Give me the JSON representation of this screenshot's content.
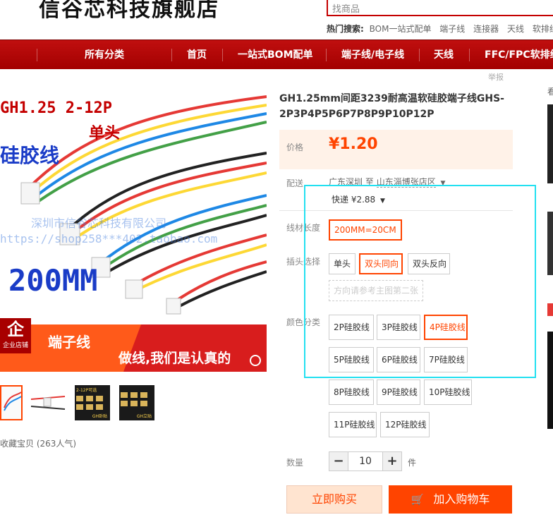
{
  "header": {
    "shop_name": "信谷芯科技旗舰店",
    "search_placeholder": "找商品",
    "hot_label": "热门搜索:",
    "hot_items": [
      "BOM一站式配单",
      "端子线",
      "连接器",
      "天线",
      "软排线"
    ]
  },
  "nav": {
    "items": [
      "所有分类",
      "首页",
      "一站式BOM配单",
      "端子线/电子线",
      "天线",
      "FFC/FPC软排线"
    ]
  },
  "report": "举报",
  "gallery": {
    "main_lines": [
      "GH1.25 2-12P",
      "单头",
      "硅胶线",
      "深圳市信谷芯科技有限公司",
      "https://shop258***402.taobao.com",
      "200MM",
      "端子线",
      "做线,我们是认真的"
    ],
    "badge": "企",
    "badge_sub": "企业店铺",
    "thumb_labels": [
      "2-12P可选",
      "GH卧贴",
      "GH立贴"
    ],
    "collect": "收藏宝贝 (263人气)"
  },
  "product": {
    "title": "GH1.25mm间距3239耐高温软硅胶端子线GHS-2P3P4P5P6P7P8P9P10P12P",
    "price_label": "价格",
    "price": "¥1.20",
    "ship_label": "配送",
    "ship_from": "广东深圳",
    "ship_to_word": "至",
    "ship_to": "山东淄博张店区",
    "express": "快递 ¥2.88",
    "length_label": "线材长度",
    "length_options": [
      "200MM=20CM"
    ],
    "plug_label": "插头选择",
    "plug_options": [
      "单头",
      "双头同向",
      "双头反向"
    ],
    "plug_note": "方向请参考主图第二张",
    "color_label": "颜色分类",
    "color_options": [
      "2P硅胶线",
      "3P硅胶线",
      "4P硅胶线",
      "5P硅胶线",
      "6P硅胶线",
      "7P硅胶线",
      "8P硅胶线",
      "9P硅胶线",
      "10P硅胶线",
      "11P硅胶线",
      "12P硅胶线"
    ],
    "qty_label": "数量",
    "qty_value": "10",
    "qty_unit": "件",
    "buy_now": "立即购买",
    "add_cart": "加入购物车"
  },
  "side": {
    "label": "看"
  },
  "colors": {
    "accent": "#ff4400",
    "nav": "#b00000",
    "highlight": "#22e0f0"
  }
}
